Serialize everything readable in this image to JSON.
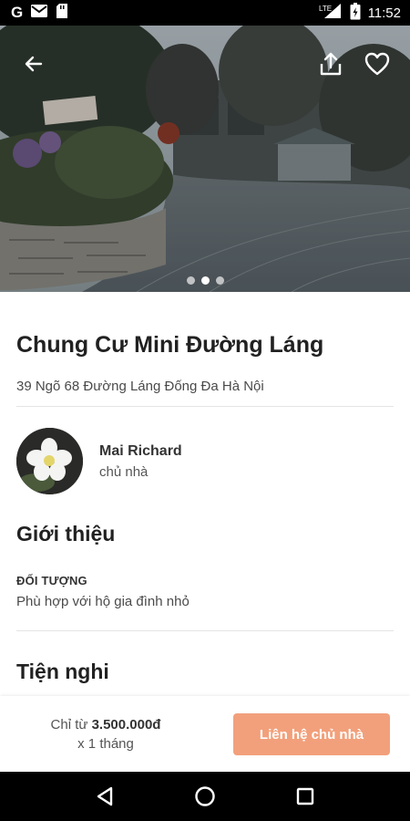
{
  "status_bar": {
    "time": "11:52",
    "network_label": "LTE",
    "icons": [
      "google-icon",
      "gmail-icon",
      "sd-card-icon",
      "signal-icon",
      "battery-icon"
    ]
  },
  "hero": {
    "image_description_icons": [
      "back-arrow-icon",
      "share-icon",
      "heart-icon"
    ],
    "carousel": {
      "count": 3,
      "active_index": 1
    }
  },
  "listing": {
    "title": "Chung Cư Mini Đường Láng",
    "address": "39 Ngõ 68 Đường Láng Đống Đa Hà Nội"
  },
  "owner": {
    "name": "Mai Richard",
    "role": "chủ nhà"
  },
  "intro": {
    "title": "Giới thiệu",
    "audience_label": "ĐỐI TƯỢNG",
    "audience_value": "Phù hợp với hộ gia đình nhỏ"
  },
  "amenities": {
    "title": "Tiện nghi"
  },
  "price_bar": {
    "prefix": "Chỉ từ",
    "price": "3.500.000đ",
    "period": "x 1 tháng",
    "contact_label": "Liên hệ chủ nhà",
    "accent_color": "#f2a07b"
  },
  "nav_bar": {
    "icons": [
      "back-triangle-icon",
      "home-circle-icon",
      "recents-square-icon"
    ]
  }
}
